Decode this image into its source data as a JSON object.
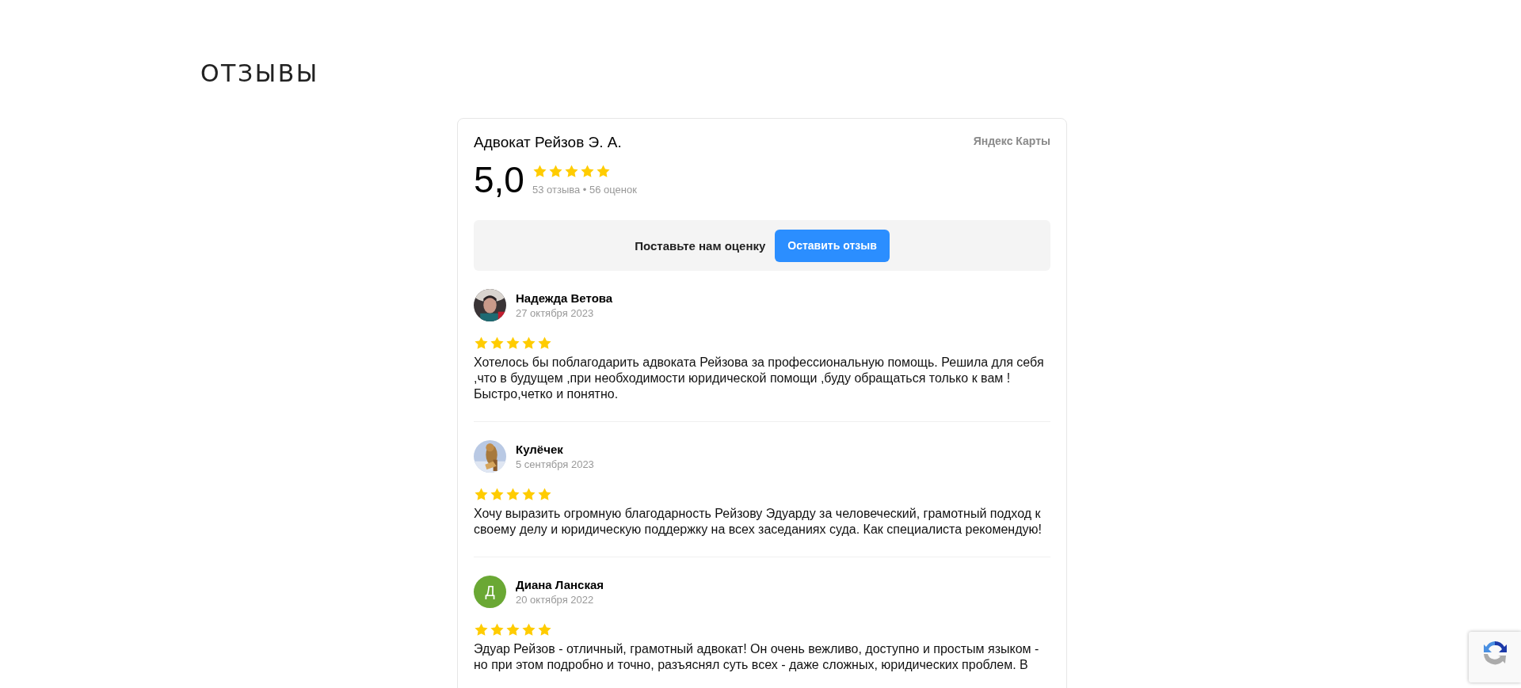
{
  "heading": "ОТЗЫВЫ",
  "widget": {
    "title": "Адвокат Рейзов Э. А.",
    "source": "Яндекс Карты",
    "rating": "5,0",
    "stars": 5,
    "counts": "53 отзыва • 56 оценок",
    "prompt": {
      "text": "Поставьте нам оценку",
      "button": "Оставить отзыв"
    },
    "reviews": [
      {
        "author": "Надежда Ветова",
        "date": "27 октября 2023",
        "stars": 5,
        "text": "Хотелось бы поблагодарить адвоката Рейзова за профессиональную помощь. Решила для себя ,что в будущем ,при необходимости юридической помощи ,буду обращаться только к вам ! Быстро,четко и понятно."
      },
      {
        "author": "Кулёчек",
        "date": "5 сентября 2023",
        "stars": 5,
        "text": "Хочу выразить огромную благодарность Рейзову Эдуарду за человеческий, грамотный подход к своему делу и юридическую поддержку на всех заседаниях суда. Как специалиста рекомендую!"
      },
      {
        "author": "Диана Ланская",
        "date": "20 октября 2022",
        "avatar": {
          "kind": "letter",
          "letter": "Д",
          "color": "#6aa834"
        },
        "stars": 5,
        "text": "Эдуар Рейзов - отличный, грамотный адвокат! Он очень вежливо, доступно и простым языком - но при этом подробно и точно, разъяснял суть всех - даже сложных, юридических проблем. В"
      }
    ]
  }
}
